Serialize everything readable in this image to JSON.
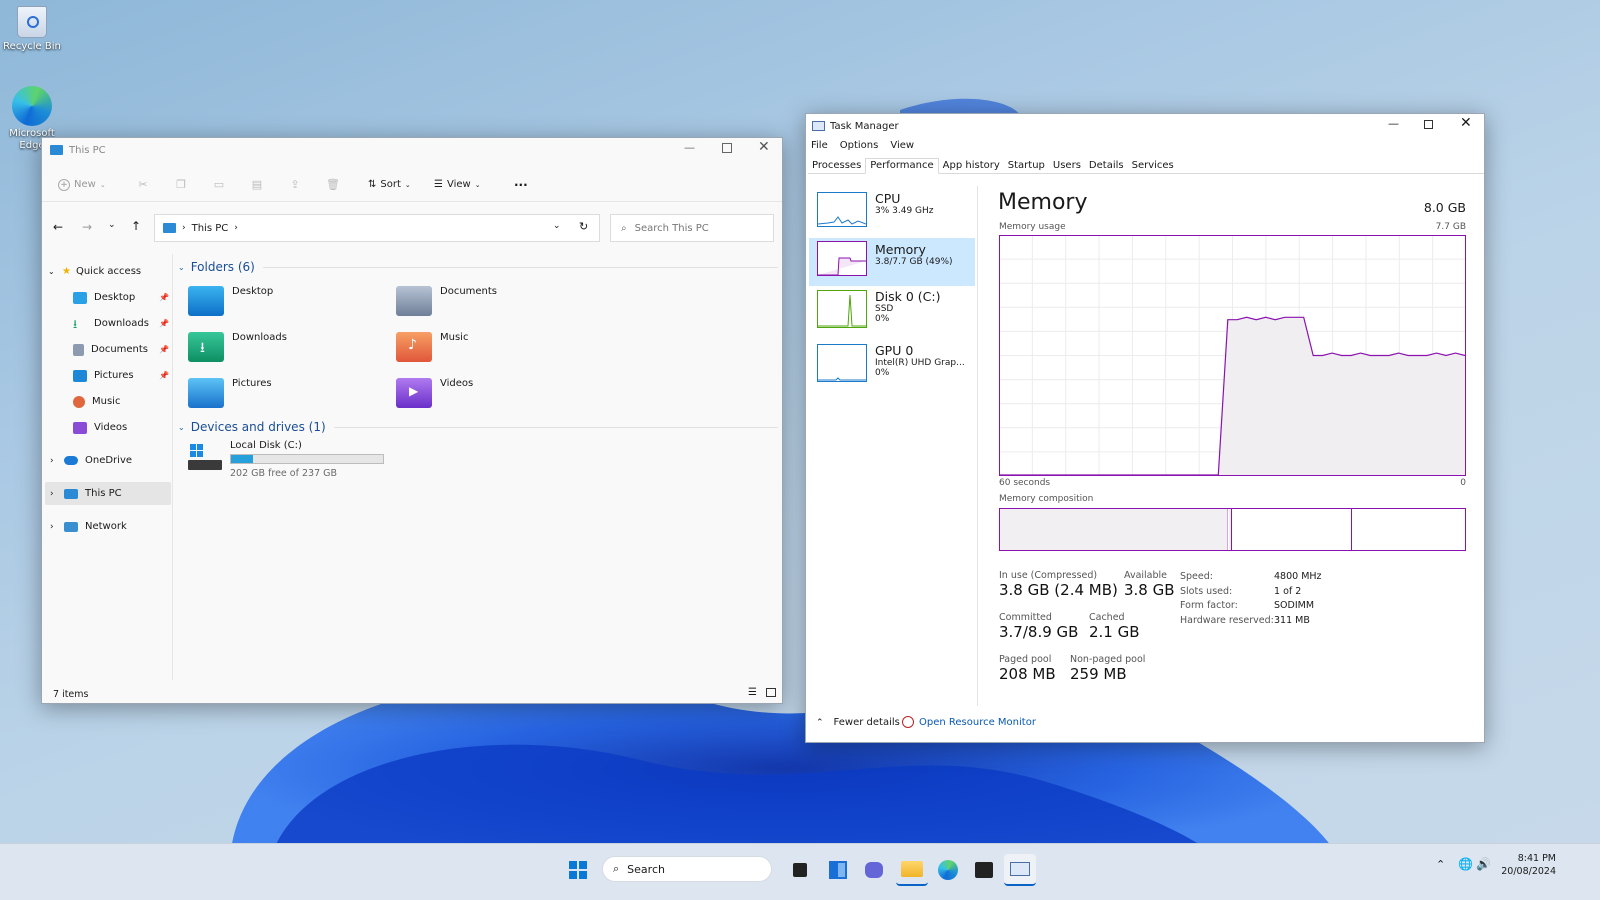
{
  "desktop": {
    "icons": [
      {
        "label": "Recycle Bin"
      },
      {
        "label": "Microsoft Edge"
      }
    ]
  },
  "explorer": {
    "title": "This PC",
    "toolbar": {
      "new": "New",
      "sort": "Sort",
      "view": "View",
      "more": "···"
    },
    "address": {
      "path": "This PC",
      "search_placeholder": "Search This PC"
    },
    "nav": {
      "quick_access": "Quick access",
      "items": [
        {
          "label": "Desktop",
          "pinned": true
        },
        {
          "label": "Downloads",
          "pinned": true
        },
        {
          "label": "Documents",
          "pinned": true
        },
        {
          "label": "Pictures",
          "pinned": true
        },
        {
          "label": "Music",
          "pinned": false
        },
        {
          "label": "Videos",
          "pinned": false
        }
      ],
      "onedrive": "OneDrive",
      "this_pc": "This PC",
      "network": "Network"
    },
    "folders_header": "Folders (6)",
    "folders": [
      "Desktop",
      "Documents",
      "Downloads",
      "Music",
      "Pictures",
      "Videos"
    ],
    "drives_header": "Devices and drives (1)",
    "drive": {
      "name": "Local Disk (C:)",
      "free": "202 GB free of 237 GB",
      "used_fraction": 0.148
    },
    "status": "7 items"
  },
  "taskmanager": {
    "title": "Task Manager",
    "menu": [
      "File",
      "Options",
      "View"
    ],
    "tabs": [
      "Processes",
      "Performance",
      "App history",
      "Startup",
      "Users",
      "Details",
      "Services"
    ],
    "active_tab": "Performance",
    "sidebar": [
      {
        "name": "CPU",
        "l1": "3%  3.49 GHz",
        "l2": ""
      },
      {
        "name": "Memory",
        "l1": "3.8/7.7 GB (49%)",
        "l2": ""
      },
      {
        "name": "Disk 0 (C:)",
        "l1": "SSD",
        "l2": "0%"
      },
      {
        "name": "GPU 0",
        "l1": "Intel(R) UHD Grap...",
        "l2": "0%"
      }
    ],
    "heading": "Memory",
    "total": "8.0 GB",
    "usage_label": "Memory usage",
    "usage_max": "7.7 GB",
    "axis_left": "60 seconds",
    "axis_right": "0",
    "composition_label": "Memory composition",
    "usage_series": [
      0,
      0,
      0,
      0,
      0,
      0,
      0,
      0,
      0,
      0,
      0,
      0,
      0,
      0,
      0,
      0,
      0,
      0,
      0,
      0,
      0,
      0,
      0,
      0,
      0.65,
      0.65,
      0.66,
      0.65,
      0.66,
      0.65,
      0.66,
      0.66,
      0.66,
      0.5,
      0.5,
      0.51,
      0.5,
      0.5,
      0.51,
      0.5,
      0.5,
      0.5,
      0.51,
      0.5,
      0.5,
      0.5,
      0.51,
      0.5,
      0.51,
      0.5
    ],
    "stats": {
      "in_use_label": "In use (Compressed)",
      "in_use": "3.8 GB (2.4 MB)",
      "available_label": "Available",
      "available": "3.8 GB",
      "committed_label": "Committed",
      "committed": "3.7/8.9 GB",
      "cached_label": "Cached",
      "cached": "2.1 GB",
      "paged_label": "Paged pool",
      "paged": "208 MB",
      "nonpaged_label": "Non-paged pool",
      "nonpaged": "259 MB"
    },
    "specs": [
      {
        "k": "Speed:",
        "v": "4800 MHz"
      },
      {
        "k": "Slots used:",
        "v": "1 of 2"
      },
      {
        "k": "Form factor:",
        "v": "SODIMM"
      },
      {
        "k": "Hardware reserved:",
        "v": "311 MB"
      }
    ],
    "fewer_details": "Fewer details",
    "resource_monitor": "Open Resource Monitor"
  },
  "taskbar": {
    "search": "Search",
    "time": "8:41 PM",
    "date": "20/08/2024"
  }
}
